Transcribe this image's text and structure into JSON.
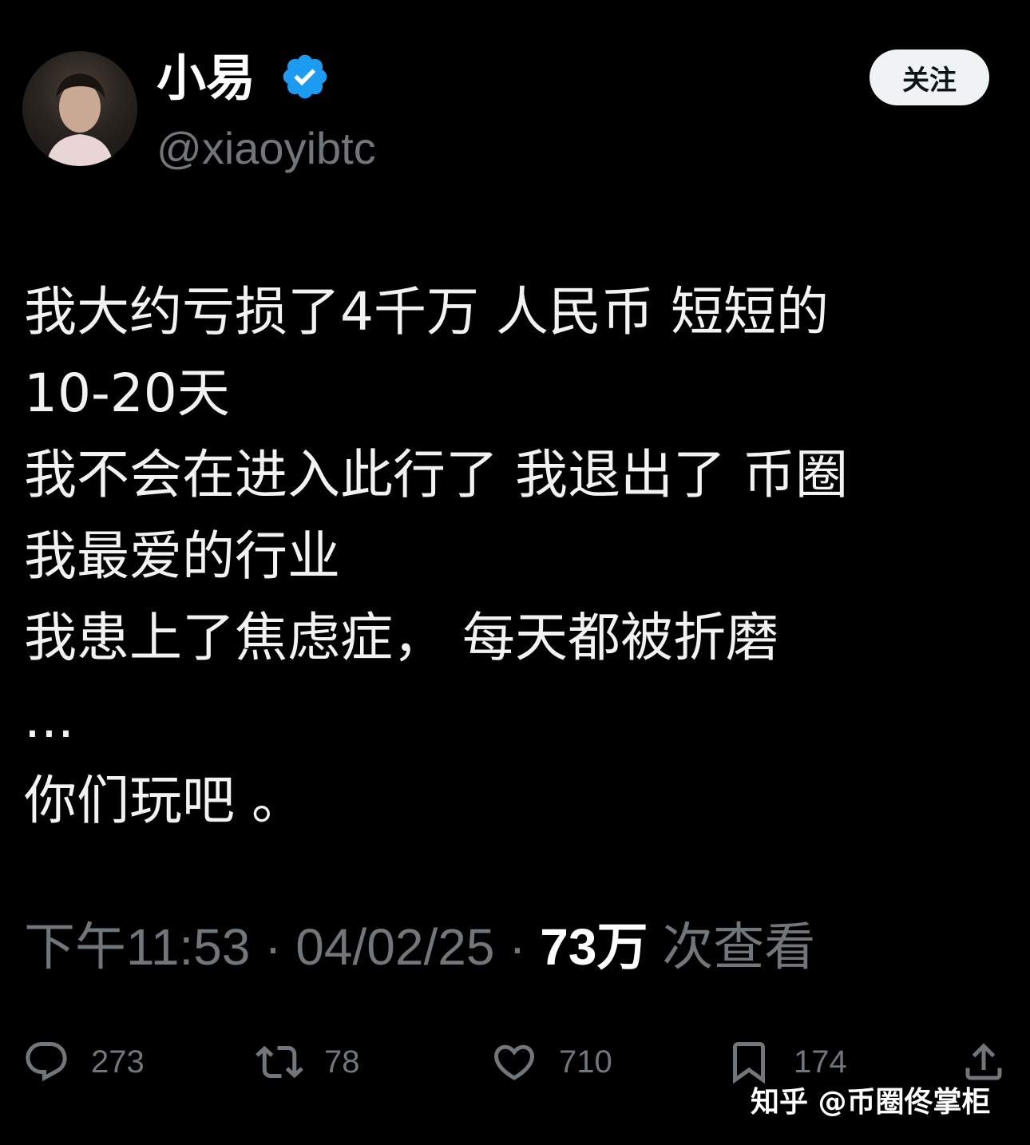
{
  "profile": {
    "display_name": "小易",
    "handle": "@xiaoyibtc",
    "verified_color": "#1d9bf0",
    "follow_label": "关注"
  },
  "tweet": {
    "lines": [
      "我大约亏损了4千万 人民币 短短的",
      "10-20天",
      "我不会在进入此行了 我退出了 币圈",
      "我最爱的行业",
      "我患上了焦虑症， 每天都被折磨",
      "...",
      "你们玩吧 。"
    ]
  },
  "meta": {
    "time": "下午11:53",
    "separator": "·",
    "date": "04/02/25",
    "views_count": "73万",
    "views_label": "次查看"
  },
  "actions": {
    "reply": {
      "icon": "reply-icon",
      "count": "273"
    },
    "retweet": {
      "icon": "retweet-icon",
      "count": "78"
    },
    "like": {
      "icon": "heart-icon",
      "count": "710"
    },
    "bookmark": {
      "icon": "bookmark-icon",
      "count": "174"
    },
    "share": {
      "icon": "share-icon"
    }
  },
  "watermark": {
    "text": "知乎 @币圈佟掌柜"
  },
  "colors": {
    "background": "#000000",
    "text": "#e7e9ea",
    "muted": "#71767b",
    "follow_bg": "#eff3f4"
  }
}
